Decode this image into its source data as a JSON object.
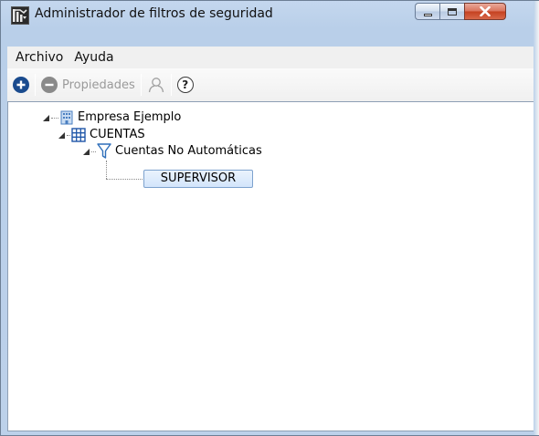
{
  "window": {
    "title": "Administrador de filtros de seguridad",
    "app_icon": "security-filter-app-icon",
    "controls": [
      "minimize-icon",
      "maximize-icon",
      "close-icon"
    ]
  },
  "menu": {
    "items": [
      {
        "label": "Archivo"
      },
      {
        "label": "Ayuda"
      }
    ]
  },
  "toolbar": {
    "add_icon": "plus-circle-icon",
    "remove_icon": "minus-circle-icon",
    "properties_label": "Propiedades",
    "user_icon": "user-icon",
    "help_icon": "question-circle-icon",
    "help_glyph": "?"
  },
  "tree": {
    "nodes": [
      {
        "label": "Empresa Ejemplo",
        "icon": "building-icon",
        "expanded": true
      },
      {
        "label": "CUENTAS",
        "icon": "table-grid-icon",
        "expanded": true
      },
      {
        "label": "Cuentas No Automáticas",
        "icon": "funnel-filter-icon",
        "expanded": true
      },
      {
        "label": "SUPERVISOR",
        "icon": "",
        "selected": true
      }
    ]
  },
  "colors": {
    "title_bar": "#c4d7ee",
    "add_icon": "#1a4b8e",
    "filter_icon": "#2f6fba",
    "grid_icon": "#1f56a8",
    "building_icon": "#4a7fc1",
    "selection_border": "#7da2ce"
  }
}
